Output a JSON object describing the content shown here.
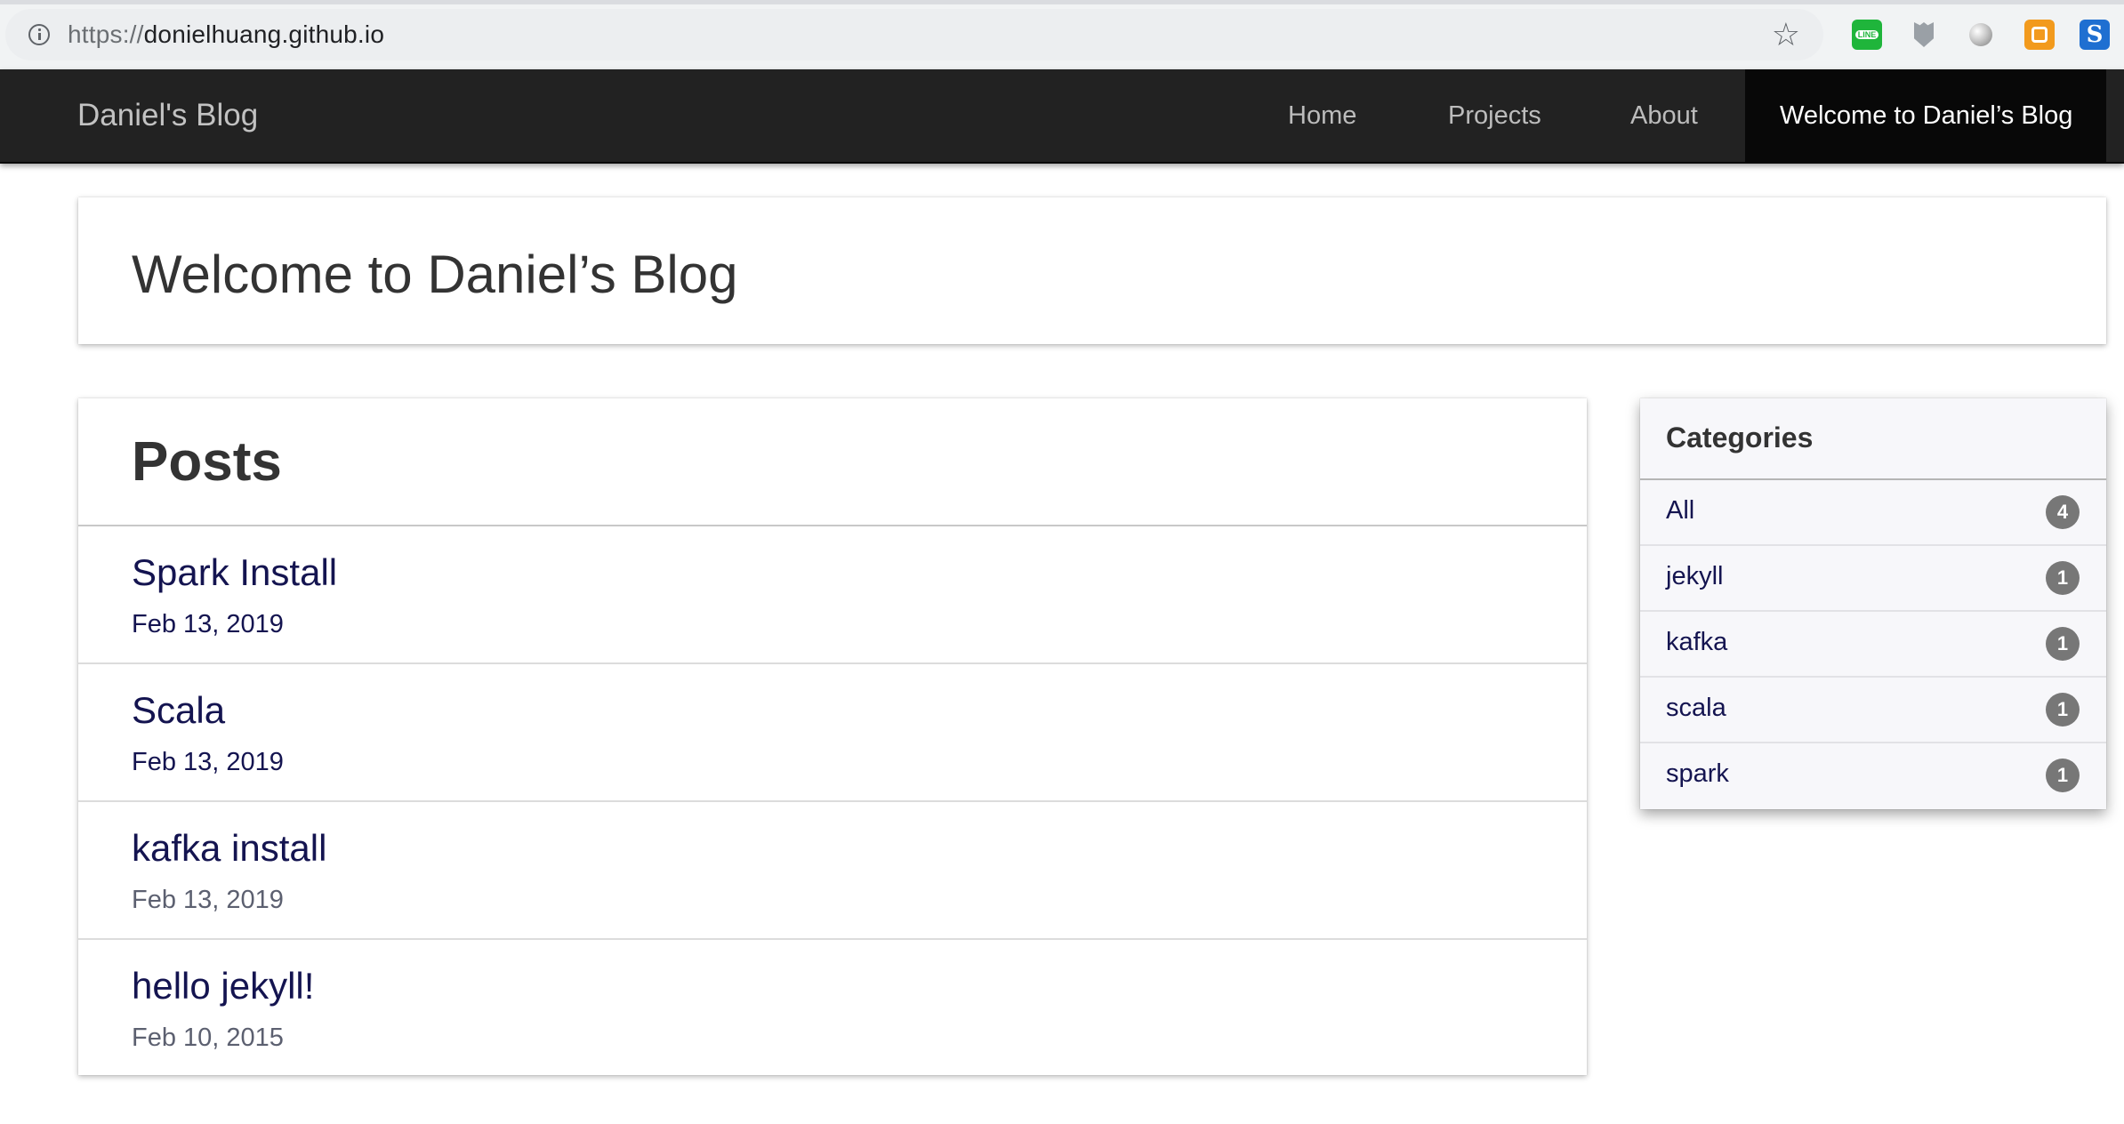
{
  "browser": {
    "url_scheme": "https://",
    "url_host": "donielhuang.github.io"
  },
  "navbar": {
    "brand": "Daniel's Blog",
    "items": [
      {
        "label": "Home"
      },
      {
        "label": "Projects"
      },
      {
        "label": "About"
      },
      {
        "label": "Welcome to Daniel’s Blog",
        "active": true
      }
    ]
  },
  "welcome": {
    "title": "Welcome to Daniel’s Blog"
  },
  "posts": {
    "heading": "Posts",
    "items": [
      {
        "title": "Spark Install",
        "date": "Feb 13, 2019"
      },
      {
        "title": "Scala",
        "date": "Feb 13, 2019"
      },
      {
        "title": "kafka install",
        "date": "Feb 13, 2019"
      },
      {
        "title": "hello jekyll!",
        "date": "Feb 10, 2015"
      }
    ]
  },
  "categories": {
    "heading": "Categories",
    "items": [
      {
        "label": "All",
        "count": "4"
      },
      {
        "label": "jekyll",
        "count": "1"
      },
      {
        "label": "kafka",
        "count": "1"
      },
      {
        "label": "scala",
        "count": "1"
      },
      {
        "label": "spark",
        "count": "1"
      }
    ]
  },
  "colors": {
    "navbar_bg": "#222222",
    "nav_active_bg": "#080808",
    "link": "#141450",
    "badge": "#777777"
  }
}
